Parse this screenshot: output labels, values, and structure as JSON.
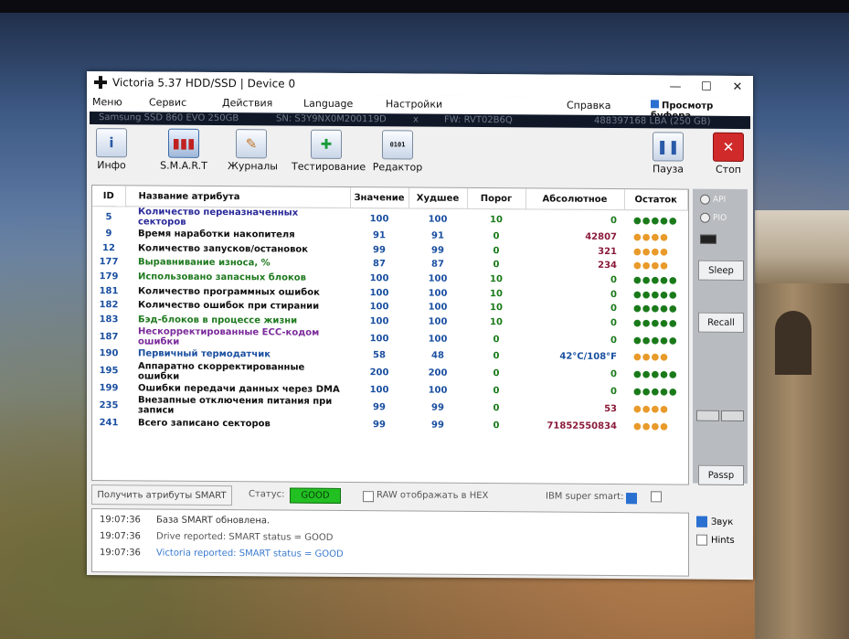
{
  "window": {
    "title": "Victoria 5.37 HDD/SSD | Device 0",
    "controls": [
      "—",
      "☐",
      "✕"
    ]
  },
  "menu": {
    "items": [
      "Меню",
      "Сервис",
      "Действия",
      "Language",
      "Настройки",
      "Справка"
    ],
    "clipboard": "Просмотр буфера"
  },
  "device": {
    "model": "Samsung SSD 860 EVO 250GB",
    "serial": "SN: S3Y9NX0M200119D",
    "close": "x",
    "firmware": "FW: RVT02B6Q",
    "lba": "488397168 LBA (250 GB)"
  },
  "toolbar": {
    "info": "Инфо",
    "smart": "S.M.A.R.T",
    "logs": "Журналы",
    "testing": "Тестирование",
    "editor": "Редактор",
    "pause": "Пауза",
    "stop": "Стоп"
  },
  "table": {
    "headers": [
      "ID",
      "Название атрибута",
      "Значение",
      "Худшее",
      "Порог",
      "Абсолютное",
      "Остаток"
    ],
    "rows": [
      {
        "id": "5",
        "name": "Количество переназначенных секторов",
        "value": "100",
        "worst": "100",
        "thr": "10",
        "abs": "0",
        "rem": "●●●●●",
        "nc": "#2a2a9a",
        "rc": "#1a7a1a"
      },
      {
        "id": "9",
        "name": "Время наработки накопителя",
        "value": "91",
        "worst": "91",
        "thr": "0",
        "abs": "42807",
        "rem": "●●●●",
        "nc": "#111111",
        "rc": "#e89a2a"
      },
      {
        "id": "12",
        "name": "Количество запусков/остановок",
        "value": "99",
        "worst": "99",
        "thr": "0",
        "abs": "321",
        "rem": "●●●●",
        "nc": "#111111",
        "rc": "#e89a2a"
      },
      {
        "id": "177",
        "name": "Выравнивание износа, %",
        "value": "87",
        "worst": "87",
        "thr": "0",
        "abs": "234",
        "rem": "●●●●",
        "nc": "#1f7a1f",
        "rc": "#e89a2a"
      },
      {
        "id": "179",
        "name": "Использовано запасных блоков",
        "value": "100",
        "worst": "100",
        "thr": "10",
        "abs": "0",
        "rem": "●●●●●",
        "nc": "#1f7a1f",
        "rc": "#1a7a1a"
      },
      {
        "id": "181",
        "name": "Количество программных ошибок",
        "value": "100",
        "worst": "100",
        "thr": "10",
        "abs": "0",
        "rem": "●●●●●",
        "nc": "#111111",
        "rc": "#1a7a1a"
      },
      {
        "id": "182",
        "name": "Количество ошибок при стирании",
        "value": "100",
        "worst": "100",
        "thr": "10",
        "abs": "0",
        "rem": "●●●●●",
        "nc": "#111111",
        "rc": "#1a7a1a"
      },
      {
        "id": "183",
        "name": "Бэд-блоков в процессе жизни",
        "value": "100",
        "worst": "100",
        "thr": "10",
        "abs": "0",
        "rem": "●●●●●",
        "nc": "#1f7a1f",
        "rc": "#1a7a1a"
      },
      {
        "id": "187",
        "name": "Нескорректированные ECC-кодом ошибки",
        "value": "100",
        "worst": "100",
        "thr": "0",
        "abs": "0",
        "rem": "●●●●●",
        "nc": "#7a2a9a",
        "rc": "#1a7a1a"
      },
      {
        "id": "190",
        "name": "Первичный термодатчик",
        "value": "58",
        "worst": "48",
        "thr": "0",
        "abs": "42°C/108°F",
        "rem": "●●●●",
        "nc": "#1a4fa0",
        "rc": "#e89a2a"
      },
      {
        "id": "195",
        "name": "Аппаратно скорректированные ошибки",
        "value": "200",
        "worst": "200",
        "thr": "0",
        "abs": "0",
        "rem": "●●●●●",
        "nc": "#111111",
        "rc": "#1a7a1a"
      },
      {
        "id": "199",
        "name": "Ошибки передачи данных через DMA",
        "value": "100",
        "worst": "100",
        "thr": "0",
        "abs": "0",
        "rem": "●●●●●",
        "nc": "#111111",
        "rc": "#1a7a1a"
      },
      {
        "id": "235",
        "name": "Внезапные отключения питания при записи",
        "value": "99",
        "worst": "99",
        "thr": "0",
        "abs": "53",
        "rem": "●●●●",
        "nc": "#111111",
        "rc": "#e89a2a"
      },
      {
        "id": "241",
        "name": "Всего записано секторов",
        "value": "99",
        "worst": "99",
        "thr": "0",
        "abs": "71852550834",
        "rem": "●●●●",
        "nc": "#111111",
        "rc": "#e89a2a"
      }
    ]
  },
  "side": {
    "api": "API",
    "pio": "PIO",
    "sleep": "Sleep",
    "recall": "Recall",
    "passp": "Passp"
  },
  "status": {
    "get_smart": "Получить атрибуты SMART",
    "status_label": "Статус:",
    "status_value": "GOOD",
    "raw_hex": "RAW отображать в HEX",
    "ibm": "IBM super smart:"
  },
  "log": [
    {
      "time": "19:07:36",
      "text": "База SMART обновлена.",
      "color": "#333333"
    },
    {
      "time": "19:07:36",
      "text": "Drive reported: SMART status = GOOD",
      "color": "#555555"
    },
    {
      "time": "19:07:36",
      "text": "Victoria reported: SMART status = GOOD",
      "color": "#3a7ad0"
    }
  ],
  "log_side": {
    "sound": "Звук",
    "hints": "Hints"
  }
}
